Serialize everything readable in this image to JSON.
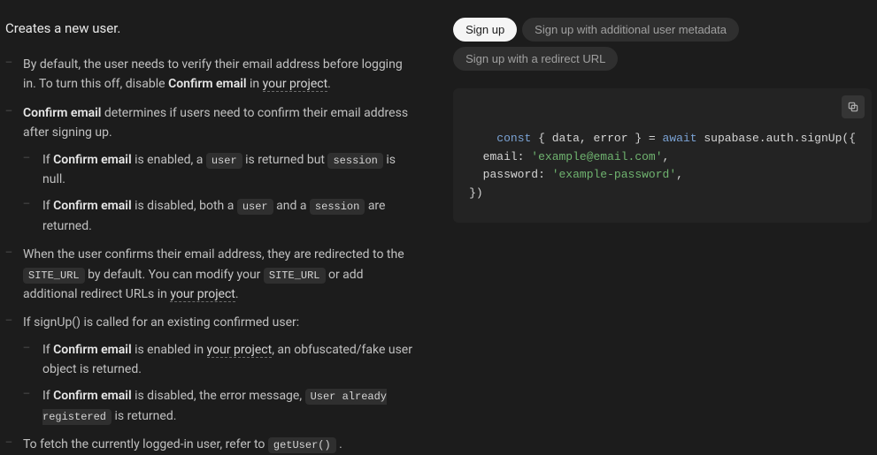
{
  "title": "Creates a new user.",
  "bullets": {
    "b1_a": "By default, the user needs to verify their email address before logging in. To turn this off, disable ",
    "b1_strong": "Confirm email",
    "b1_b": " in ",
    "b1_link": "your project",
    "b1_c": ".",
    "b2_strong": "Confirm email",
    "b2_a": " determines if users need to confirm their email address after signing up.",
    "b2_1_a": "If ",
    "b2_1_strong": "Confirm email",
    "b2_1_b": " is enabled, a ",
    "b2_1_code1": "user",
    "b2_1_c": " is returned but ",
    "b2_1_code2": "session",
    "b2_1_d": " is null.",
    "b2_2_a": "If ",
    "b2_2_strong": "Confirm email",
    "b2_2_b": " is disabled, both a ",
    "b2_2_code1": "user",
    "b2_2_c": " and a ",
    "b2_2_code2": "session",
    "b2_2_d": " are returned.",
    "b3_a": "When the user confirms their email address, they are redirected to the ",
    "b3_code1": "SITE_URL",
    "b3_b": " by default. You can modify your ",
    "b3_code2": "SITE_URL",
    "b3_c": " or add additional redirect URLs in ",
    "b3_link": "your project",
    "b3_d": ".",
    "b4_a": "If signUp() is called for an existing confirmed user:",
    "b4_1_a": "If ",
    "b4_1_strong": "Confirm email",
    "b4_1_b": " is enabled in ",
    "b4_1_link": "your project",
    "b4_1_c": ", an obfuscated/fake user object is returned.",
    "b4_2_a": "If ",
    "b4_2_strong": "Confirm email",
    "b4_2_b": " is disabled, the error message, ",
    "b4_2_code": "User already registered",
    "b4_2_c": " is returned.",
    "b5_a": "To fetch the currently logged-in user, refer to ",
    "b5_code": "getUser()",
    "b5_b": " ."
  },
  "tabs": {
    "t1": "Sign up",
    "t2": "Sign up with additional user metadata",
    "t3": "Sign up with a redirect URL"
  },
  "code": {
    "kw_const": "const",
    "destruct": " { data, error } = ",
    "kw_await": "await",
    "call_open": " supabase.auth.signUp({",
    "email_key": "  email: ",
    "email_val": "'example@email.com'",
    "comma1": ",",
    "password_key": "  password: ",
    "password_val": "'example-password'",
    "comma2": ",",
    "close": "})"
  }
}
